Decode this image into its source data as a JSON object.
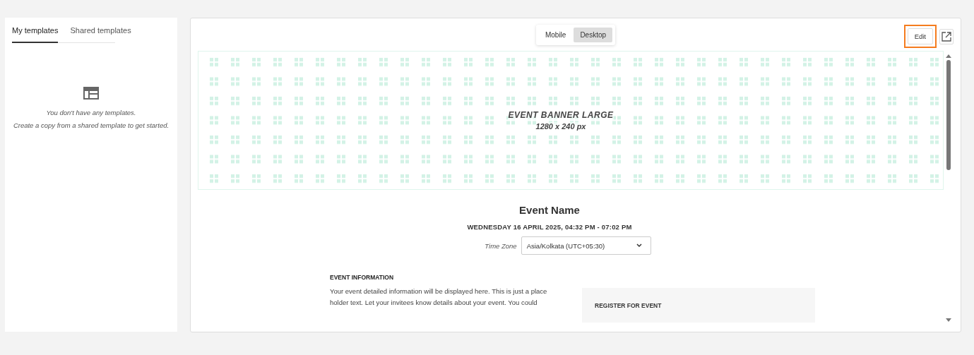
{
  "sidebar": {
    "tabs": [
      {
        "label": "My templates",
        "selected": true
      },
      {
        "label": "Shared templates",
        "selected": false
      }
    ],
    "empty_state": {
      "title": "You don't have any templates.",
      "hint": "Create a copy from a shared template to get started."
    }
  },
  "preview": {
    "view_modes": [
      {
        "label": "Mobile",
        "selected": false
      },
      {
        "label": "Desktop",
        "selected": true
      }
    ],
    "edit_button": {
      "label": "Edit",
      "highlighted": true
    },
    "banner": {
      "title": "EVENT BANNER LARGE",
      "size": "1280 x 240 px"
    },
    "event_name": "Event Name",
    "datetime": "WEDNESDAY 16 APRIL 2025, 04:32 PM - 07:02 PM",
    "time_zone": {
      "label": "Time Zone",
      "value": "Asia/Kolkata (UTC+05:30)"
    },
    "info": {
      "heading": "EVENT INFORMATION",
      "text": "Your event detailed information will be displayed here. This is just a place holder text. Let your invitees know details about your event. You could"
    },
    "register": {
      "heading": "REGISTER FOR EVENT"
    }
  }
}
